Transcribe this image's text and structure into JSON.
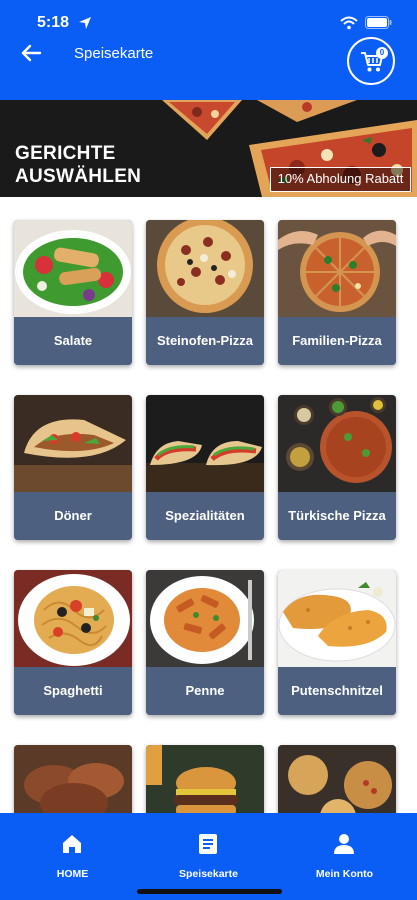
{
  "status_bar": {
    "time": "5:18"
  },
  "header": {
    "title": "Speisekarte",
    "cart_count": "0"
  },
  "banner": {
    "title_line1": "GERICHTE",
    "title_line2": "AUSWÄHLEN",
    "badge": "10% Abholung Rabatt"
  },
  "categories": [
    {
      "label": "Salate"
    },
    {
      "label": "Steinofen-Pizza"
    },
    {
      "label": "Familien-Pizza"
    },
    {
      "label": "Döner"
    },
    {
      "label": "Spezialitäten"
    },
    {
      "label": "Türkische Pizza"
    },
    {
      "label": "Spaghetti"
    },
    {
      "label": "Penne"
    },
    {
      "label": "Putenschnitzel"
    }
  ],
  "bottom_nav": [
    {
      "label": "HOME",
      "icon": "home-icon"
    },
    {
      "label": "Speisekarte",
      "icon": "menu-book-icon"
    },
    {
      "label": "Mein Konto",
      "icon": "person-icon"
    }
  ],
  "colors": {
    "primary": "#0a5ef5",
    "card_label_bg": "#4d607f",
    "banner_bg": "#1a1a1a"
  }
}
